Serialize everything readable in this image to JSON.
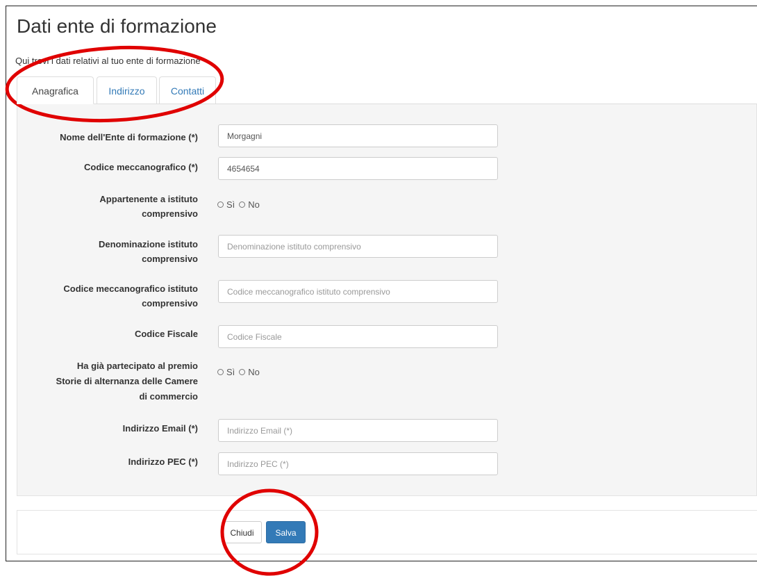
{
  "header": {
    "title": "Dati ente di formazione",
    "subtitle": "Qui trovi i dati relativi al tuo ente di formazione"
  },
  "tabs": [
    {
      "label": "Anagrafica",
      "active": true
    },
    {
      "label": "Indirizzo",
      "active": false
    },
    {
      "label": "Contatti",
      "active": false
    }
  ],
  "form": {
    "nome_ente": {
      "label": "Nome dell'Ente di formazione (*)",
      "value": "Morgagni"
    },
    "codice_mecc": {
      "label": "Codice meccanografico (*)",
      "value": "4654654"
    },
    "appartenente": {
      "label_1": "Appartenente a istituto",
      "label_2": "comprensivo",
      "opt_yes": "Sì",
      "opt_no": "No"
    },
    "denominazione": {
      "label_1": "Denominazione istituto",
      "label_2": "comprensivo",
      "placeholder": "Denominazione istituto comprensivo"
    },
    "codice_mecc_ist": {
      "label_1": "Codice meccanografico istituto",
      "label_2": "comprensivo",
      "placeholder": "Codice meccanografico istituto comprensivo"
    },
    "codice_fiscale": {
      "label": "Codice Fiscale",
      "placeholder": "Codice Fiscale"
    },
    "premio": {
      "label_1": "Ha già partecipato al premio",
      "label_2": "Storie di alternanza delle Camere",
      "label_3": "di commercio",
      "opt_yes": "Sì",
      "opt_no": "No"
    },
    "email": {
      "label": "Indirizzo Email (*)",
      "placeholder": "Indirizzo Email (*)"
    },
    "pec": {
      "label": "Indirizzo PEC (*)",
      "placeholder": "Indirizzo PEC (*)"
    }
  },
  "footer": {
    "close_label": "Chiudi",
    "save_label": "Salva"
  },
  "colors": {
    "primary": "#337ab7",
    "link": "#337ab7",
    "annotation": "#e00000",
    "panel_bg": "#f5f5f5"
  }
}
